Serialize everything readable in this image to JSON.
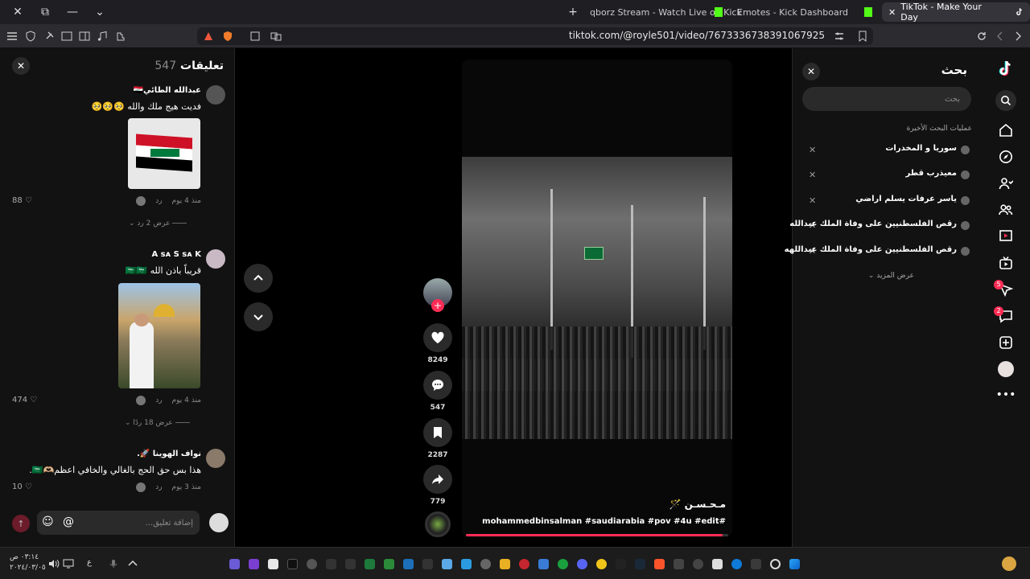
{
  "browser": {
    "tabs": [
      {
        "label": "qborz Stream - Watch Live on Kick",
        "active": false,
        "icon": "kick-icon"
      },
      {
        "label": "Emotes - Kick Dashboard",
        "active": false,
        "icon": "kick-icon"
      },
      {
        "label": "TikTok - Make Your Day",
        "active": true,
        "icon": "tiktok-icon"
      }
    ],
    "url": "tiktok.com/@royle501/video/7673336738391067925"
  },
  "comments": {
    "title": "تعليقات",
    "count": "547",
    "items": [
      {
        "name": "عبدالله الطائي🇮🇶",
        "text": "فديت هيج ملك والله 🥺🥺🥺",
        "time": "منذ 4 يوم",
        "reply": "رد",
        "likes": "88",
        "more": "عرض 2 رد"
      },
      {
        "name": "A ꜱᴀ S ꜱᴀ K",
        "text": "قريباً باذن الله 🇸🇦🇸🇦",
        "time": "منذ 4 يوم",
        "reply": "رد",
        "likes": "474",
        "more": "عرض 18 ردًا"
      },
      {
        "name": "نواف الهوينا 🚀.",
        "text": "هذا بس حق الحج بالغالي والخافي اعظم🫶🏼🇸🇦.",
        "time": "منذ 3 يوم",
        "reply": "رد",
        "likes": "10",
        "more": ""
      }
    ],
    "input_placeholder": "إضافة تعليق..."
  },
  "video": {
    "author": "مـحـسـن 🪄",
    "tags": "#mohammedbinsalman #saudiarabia #pov #4u #edit",
    "progress": 0.98,
    "likes": "8249",
    "comments": "547",
    "saves": "2287",
    "shares": "779"
  },
  "search": {
    "title": "بحث",
    "placeholder": "بحث",
    "recent_label": "عمليات البحث الأخيرة",
    "recent": [
      "سوريا و المخدرات",
      "معيذرب قطر",
      "ياسر عرفات يسلم اراضي",
      "رقص الفلسطنيين على وفاة الملك عبدالله",
      "رقص الفلسطنيين على وفاة الملك عبداللهه"
    ],
    "more_label": "عرض المزيد"
  },
  "sidenav": {
    "badges": {
      "inbox": "5",
      "messages": "2"
    }
  },
  "taskbar": {
    "time": "٠٣:١٤ ص",
    "date": "٢٠٢٤/٠٣/٠٥",
    "lang": "ع"
  },
  "colors": {
    "accent": "#fe2c55",
    "kick": "#53fc18",
    "panel": "#121212"
  }
}
